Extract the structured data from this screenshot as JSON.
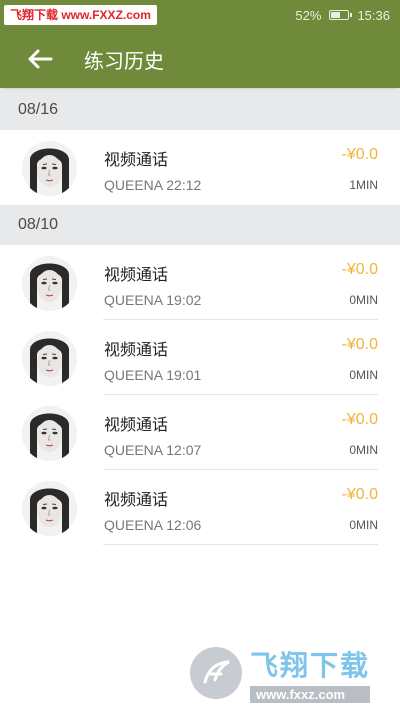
{
  "status_bar": {
    "watermark": "飞翔下载 www.FXXZ.com",
    "battery": "52%",
    "time": "15:36"
  },
  "app_bar": {
    "title": "练习历史"
  },
  "groups": [
    {
      "date": "08/16",
      "records": [
        {
          "title": "视频通话",
          "caller": "QUEENA 22:12",
          "price": "-¥0.0",
          "duration": "1MIN"
        }
      ]
    },
    {
      "date": "08/10",
      "records": [
        {
          "title": "视频通话",
          "caller": "QUEENA 19:02",
          "price": "-¥0.0",
          "duration": "0MIN"
        },
        {
          "title": "视频通话",
          "caller": "QUEENA 19:01",
          "price": "-¥0.0",
          "duration": "0MIN"
        },
        {
          "title": "视频通话",
          "caller": "QUEENA 12:07",
          "price": "-¥0.0",
          "duration": "0MIN"
        },
        {
          "title": "视频通话",
          "caller": "QUEENA 12:06",
          "price": "-¥0.0",
          "duration": "0MIN"
        }
      ]
    }
  ],
  "footer_watermark": {
    "brand": "飞翔下载",
    "url": "www.fxxz.com"
  },
  "colors": {
    "app_bar": "#6f8a3a",
    "price": "#f3b33c",
    "date_header": "#e8e9ea"
  },
  "icons": {
    "back": "arrow-left-icon",
    "battery": "battery-icon",
    "avatar": "avatar-image"
  }
}
